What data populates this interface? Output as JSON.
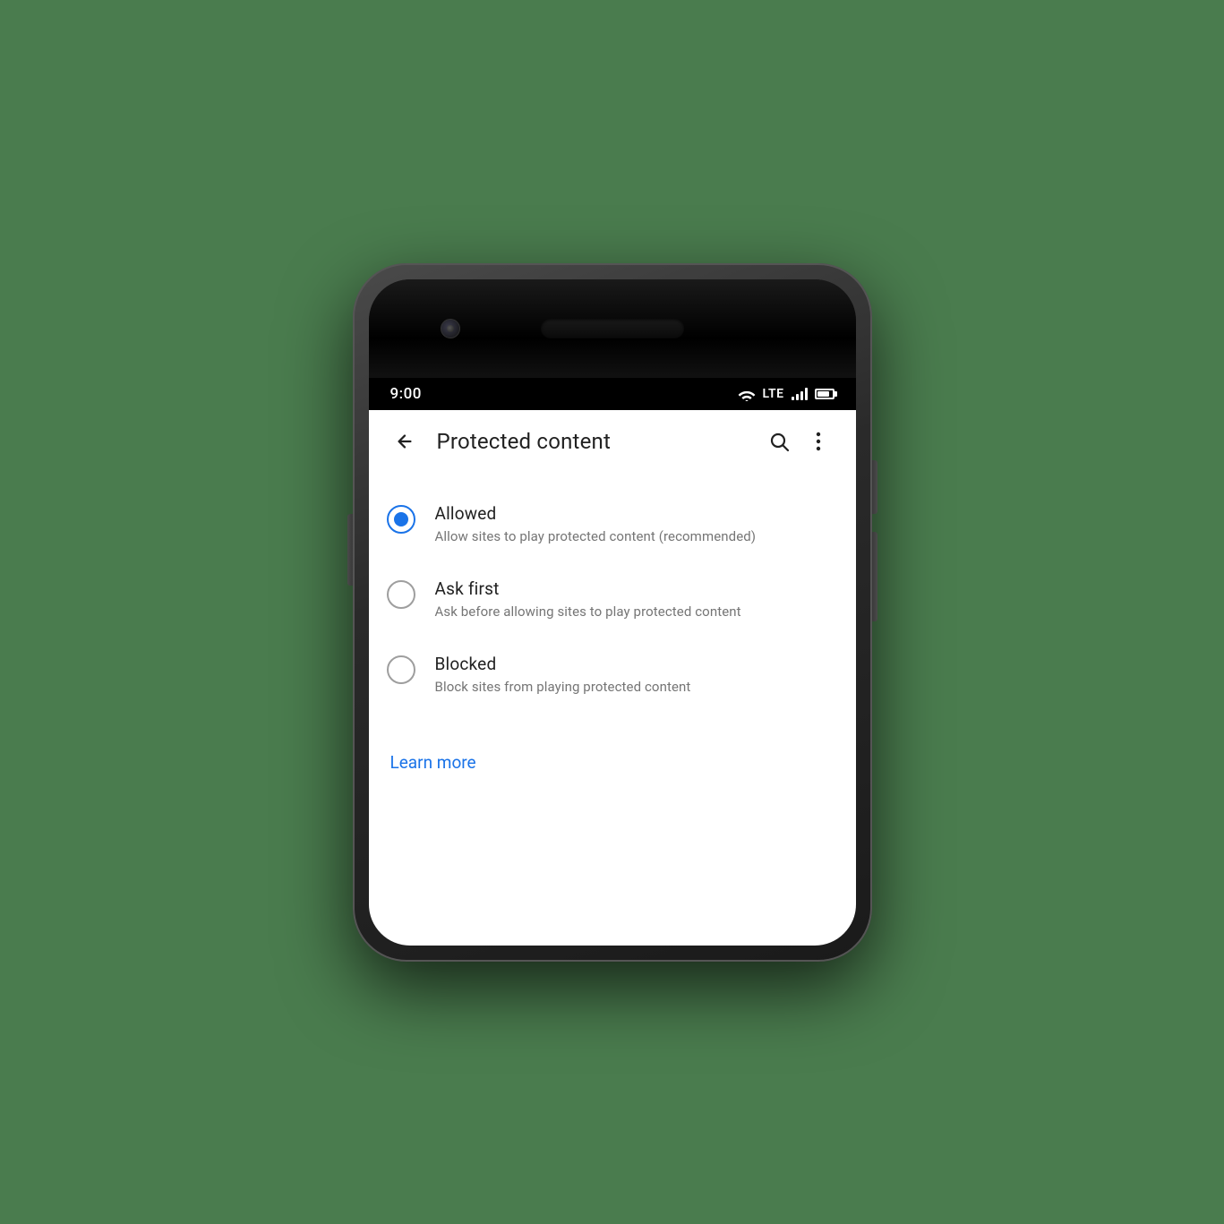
{
  "status_bar": {
    "time": "9:00",
    "lte_label": "LTE"
  },
  "app_bar": {
    "title": "Protected content",
    "back_label": "back",
    "search_label": "search",
    "more_label": "more options"
  },
  "options": [
    {
      "id": "allowed",
      "title": "Allowed",
      "description": "Allow sites to play protected content (recommended)",
      "selected": true
    },
    {
      "id": "ask-first",
      "title": "Ask first",
      "description": "Ask before allowing sites to play protected content",
      "selected": false
    },
    {
      "id": "blocked",
      "title": "Blocked",
      "description": "Block sites from playing protected content",
      "selected": false
    }
  ],
  "learn_more": {
    "label": "Learn more"
  }
}
